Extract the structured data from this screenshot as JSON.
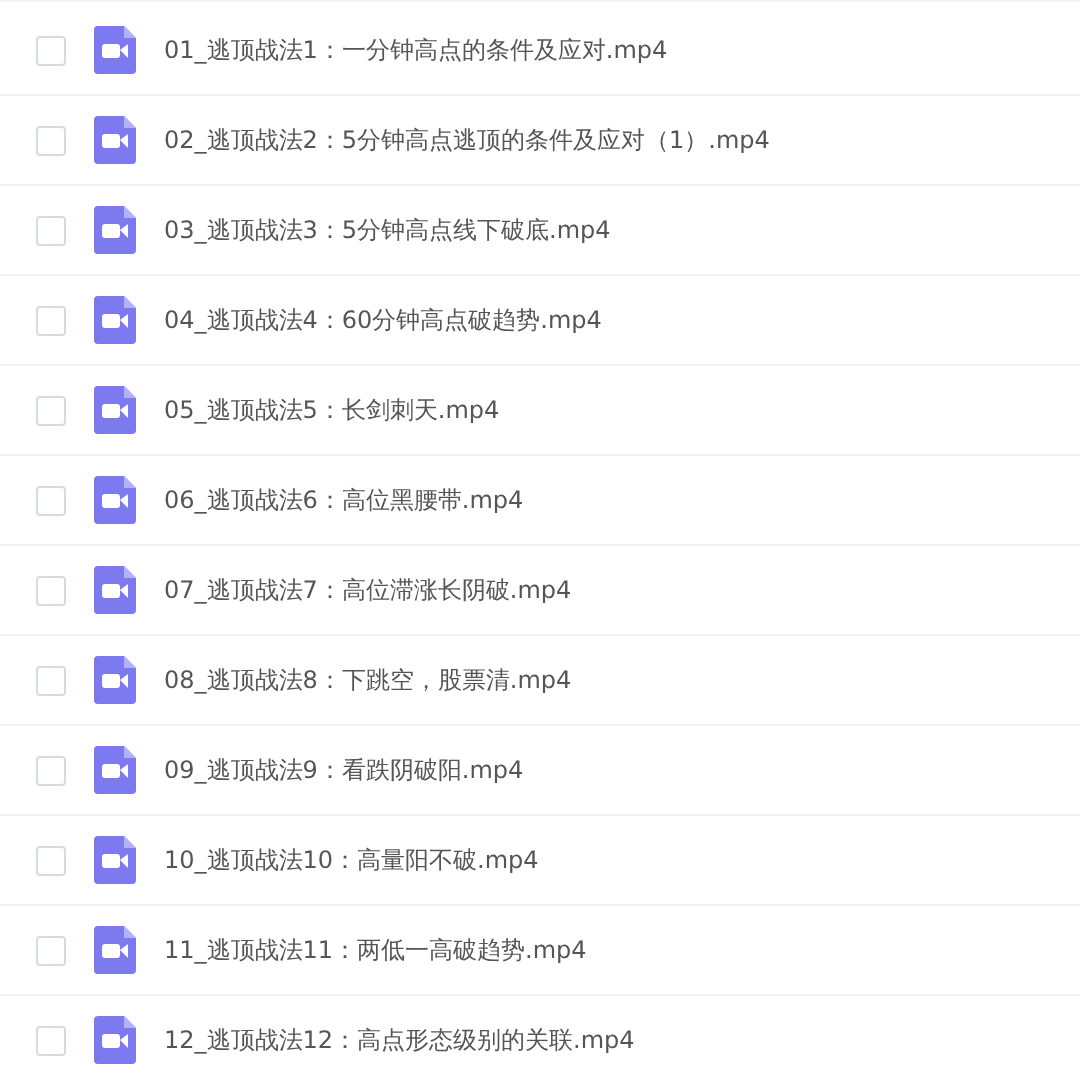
{
  "files": [
    {
      "name": "01_逃顶战法1：一分钟高点的条件及应对.mp4",
      "checked": false
    },
    {
      "name": "02_逃顶战法2：5分钟高点逃顶的条件及应对（1）.mp4",
      "checked": false
    },
    {
      "name": "03_逃顶战法3：5分钟高点线下破底.mp4",
      "checked": false
    },
    {
      "name": "04_逃顶战法4：60分钟高点破趋势.mp4",
      "checked": false
    },
    {
      "name": "05_逃顶战法5：长剑刺天.mp4",
      "checked": false
    },
    {
      "name": "06_逃顶战法6：高位黑腰带.mp4",
      "checked": false
    },
    {
      "name": "07_逃顶战法7：高位滞涨长阴破.mp4",
      "checked": false
    },
    {
      "name": "08_逃顶战法8：下跳空，股票清.mp4",
      "checked": false
    },
    {
      "name": "09_逃顶战法9：看跌阴破阳.mp4",
      "checked": false
    },
    {
      "name": "10_逃顶战法10：高量阳不破.mp4",
      "checked": false
    },
    {
      "name": "11_逃顶战法11：两低一高破趋势.mp4",
      "checked": false
    },
    {
      "name": "12_逃顶战法12：高点形态级别的关联.mp4",
      "checked": false
    }
  ]
}
